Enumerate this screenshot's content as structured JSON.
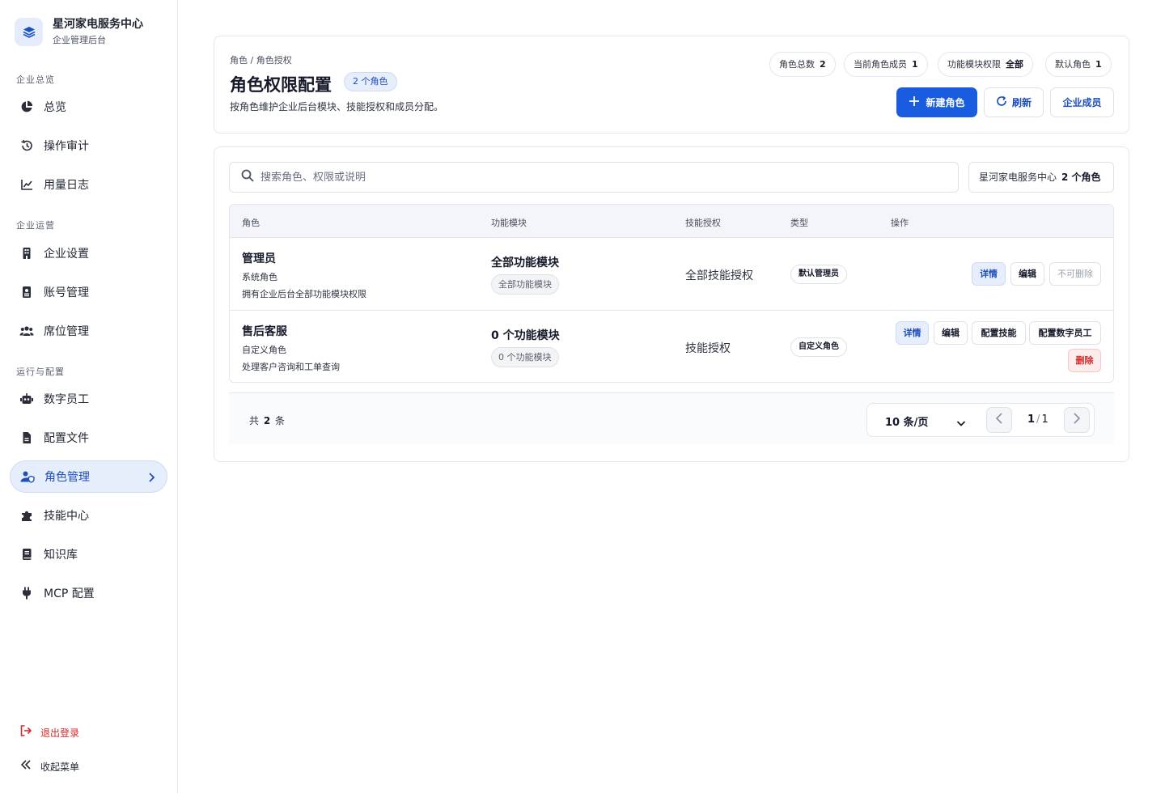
{
  "sidebar": {
    "brand_title": "星河家电服务中心",
    "brand_subtitle": "企业管理后台",
    "groups": [
      {
        "label": "企业总览",
        "items": [
          {
            "label": "总览",
            "icon": "pie-chart-icon"
          },
          {
            "label": "操作审计",
            "icon": "history-icon"
          },
          {
            "label": "用量日志",
            "icon": "line-chart-icon"
          }
        ]
      },
      {
        "label": "企业运营",
        "items": [
          {
            "label": "企业设置",
            "icon": "building-icon"
          },
          {
            "label": "账号管理",
            "icon": "id-card-icon"
          },
          {
            "label": "席位管理",
            "icon": "users-icon"
          }
        ]
      },
      {
        "label": "运行与配置",
        "items": [
          {
            "label": "数字员工",
            "icon": "robot-icon"
          },
          {
            "label": "配置文件",
            "icon": "file-icon"
          },
          {
            "label": "角色管理",
            "icon": "user-shield-icon",
            "active": true
          },
          {
            "label": "技能中心",
            "icon": "puzzle-icon"
          },
          {
            "label": "知识库",
            "icon": "book-icon"
          },
          {
            "label": "MCP 配置",
            "icon": "plug-icon"
          }
        ]
      }
    ],
    "logout_label": "退出登录",
    "collapse_label": "收起菜单"
  },
  "header": {
    "breadcrumb": "角色 / 角色授权",
    "title": "角色权限配置",
    "title_badge": "2 个角色",
    "description": "按角色维护企业后台模块、技能授权和成员分配。",
    "stats": [
      {
        "label": "角色总数",
        "value": "2"
      },
      {
        "label": "当前角色成员",
        "value": "1"
      },
      {
        "label": "功能模块权限",
        "value": "全部"
      },
      {
        "label": "默认角色",
        "value": "1"
      }
    ],
    "buttons": {
      "new_role": "新建角色",
      "refresh": "刷新",
      "members": "企业成员"
    }
  },
  "search": {
    "placeholder": "搜索角色、权限或说明",
    "value": "",
    "scope_label": "星河家电服务中心",
    "scope_count": "2 个角色"
  },
  "table": {
    "columns": [
      "角色",
      "功能模块",
      "技能授权",
      "类型",
      "操作"
    ],
    "rows": [
      {
        "name": "管理员",
        "kind": "系统角色",
        "description": "拥有企业后台全部功能模块权限",
        "module_title": "全部功能模块",
        "module_tag": "全部功能模块",
        "skill": "全部技能授权",
        "type": "默认管理员",
        "actions": {
          "detail": "详情",
          "edit": "编辑",
          "nodelete": "不可删除"
        }
      },
      {
        "name": "售后客服",
        "kind": "自定义角色",
        "description": "处理客户咨询和工单查询",
        "module_title": "0 个功能模块",
        "module_tag": "0 个功能模块",
        "skill": "技能授权",
        "type": "自定义角色",
        "actions": {
          "detail": "详情",
          "edit": "编辑",
          "config_skill": "配置技能",
          "config_worker": "配置数字员工",
          "delete": "删除"
        }
      }
    ]
  },
  "pagination": {
    "total_prefix": "共",
    "total": "2",
    "total_suffix": "条",
    "page_size": "10 条/页",
    "current": "1",
    "pages": "1"
  },
  "colors": {
    "accent": "#1a5ce0",
    "accent_soft": "#e6edfb",
    "danger": "#d32a2a",
    "border": "#e3e6ec"
  }
}
